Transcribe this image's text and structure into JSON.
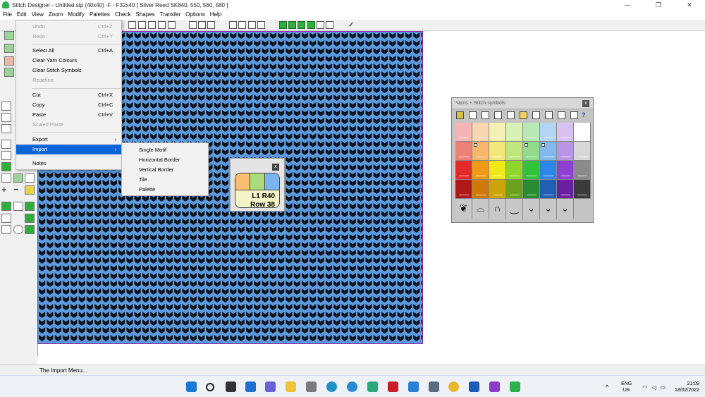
{
  "window": {
    "title": "Stitch Designer - Untitled.stp (40x40) -F - F32x40    [ Silver Reed SK840, 550, 560, 580 ]",
    "controls": [
      "—",
      "❐",
      "✕"
    ]
  },
  "menubar": [
    "File",
    "Edit",
    "View",
    "Zoom",
    "Modify",
    "Palettes",
    "Check",
    "Shapes",
    "Transfer",
    "Options",
    "Help"
  ],
  "edit_menu": {
    "items": [
      {
        "label": "Undo",
        "shortcut": "Ctrl+Z",
        "state": "disabled"
      },
      {
        "label": "Redo",
        "shortcut": "Ctrl+Y",
        "state": "disabled"
      },
      {
        "label": "Select All",
        "shortcut": "Ctrl+A",
        "state": "enabled"
      },
      {
        "label": "Clear Yarn Colours",
        "shortcut": "",
        "state": "enabled"
      },
      {
        "label": "Clear Stitch Symbols",
        "shortcut": "",
        "state": "enabled"
      },
      {
        "label": "Redefine",
        "shortcut": "",
        "state": "disabled"
      },
      {
        "label": "Cut",
        "shortcut": "Ctrl+X",
        "state": "enabled"
      },
      {
        "label": "Copy",
        "shortcut": "Ctrl+C",
        "state": "enabled"
      },
      {
        "label": "Paste",
        "shortcut": "Ctrl+V",
        "state": "enabled"
      },
      {
        "label": "Scaled Paste",
        "shortcut": "",
        "state": "disabled"
      },
      {
        "label": "Export",
        "shortcut": "",
        "state": "submenu"
      },
      {
        "label": "Import",
        "shortcut": "",
        "state": "selected"
      },
      {
        "label": "Notes",
        "shortcut": "",
        "state": "enabled"
      }
    ]
  },
  "import_submenu": [
    "Single Motif",
    "Horizontal Border",
    "Vertical Border",
    "Tile",
    "Palette"
  ],
  "position_indicator": {
    "line1": "L1 R40",
    "line2": "Row 38",
    "close": "x",
    "yarns": [
      "#f9be6f",
      "#a9dc7b",
      "#7bb4f0"
    ]
  },
  "yarn_palette": {
    "title": "Yarns + Stitch symbols",
    "close": "x",
    "rows": [
      [
        "#f6b4b4",
        "#f8d7b0",
        "#f4f0b4",
        "#d7f0b4",
        "#b8e8b4",
        "#b4d4f4",
        "#d8c0f0",
        "#ffffff"
      ],
      [
        "#ee8077",
        "#f7b66a",
        "#f1e77a",
        "#c2e67f",
        "#91db8a",
        "#84b9f0",
        "#b896e6",
        "#d8d8d8"
      ],
      [
        "#e22a2a",
        "#f39a14",
        "#f1e81a",
        "#8fd52b",
        "#33c23c",
        "#2f86ea",
        "#8f3fd2",
        "#8a8a8a"
      ],
      [
        "#b01717",
        "#cf7a08",
        "#cba40a",
        "#6ba11d",
        "#2b8c2f",
        "#1f5fb5",
        "#6a1fa0",
        "#3a3a3a"
      ]
    ],
    "symbols": [
      "❦",
      "⌓",
      "∩",
      "‿",
      "⌄",
      "⌄",
      "⌄"
    ]
  },
  "status_text": "The Import Menu...",
  "taskbar": {
    "lang_line1": "ENG",
    "lang_line2": "UK",
    "time": "21:09",
    "date": "18/02/2022",
    "tray_chevron": "^"
  },
  "colors": {
    "canvas": "#5b9be0",
    "canvas_border": "#a020a0",
    "menu_highlight": "#0a64d8"
  }
}
